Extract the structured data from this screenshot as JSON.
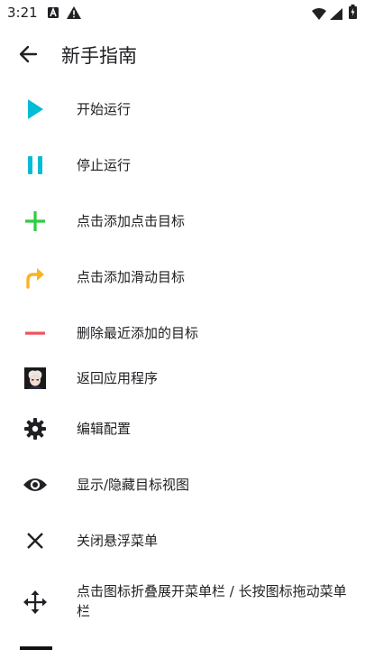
{
  "status": {
    "time": "3:21"
  },
  "header": {
    "title": "新手指南"
  },
  "items": [
    {
      "icon": "play-icon",
      "label": "开始运行",
      "color": "#00BCD4"
    },
    {
      "icon": "pause-icon",
      "label": "停止运行",
      "color": "#00BCD4"
    },
    {
      "icon": "plus-icon",
      "label": "点击添加点击目标",
      "color": "#2ECC40"
    },
    {
      "icon": "swipe-arrow-icon",
      "label": "点击添加滑动目标",
      "color": "#FBB324"
    },
    {
      "icon": "minus-icon",
      "label": "删除最近添加的目标",
      "color": "#F0525A"
    },
    {
      "icon": "app-thumbnail-icon",
      "label": "返回应用程序"
    },
    {
      "icon": "gear-icon",
      "label": "编辑配置",
      "color": "#202124"
    },
    {
      "icon": "eye-icon",
      "label": "显示/隐藏目标视图",
      "color": "#202124"
    },
    {
      "icon": "close-icon",
      "label": "关闭悬浮菜单",
      "color": "#202124"
    },
    {
      "icon": "move-icon",
      "label": "点击图标折叠展开菜单栏 / 长按图标拖动菜单栏",
      "color": "#202124"
    }
  ]
}
